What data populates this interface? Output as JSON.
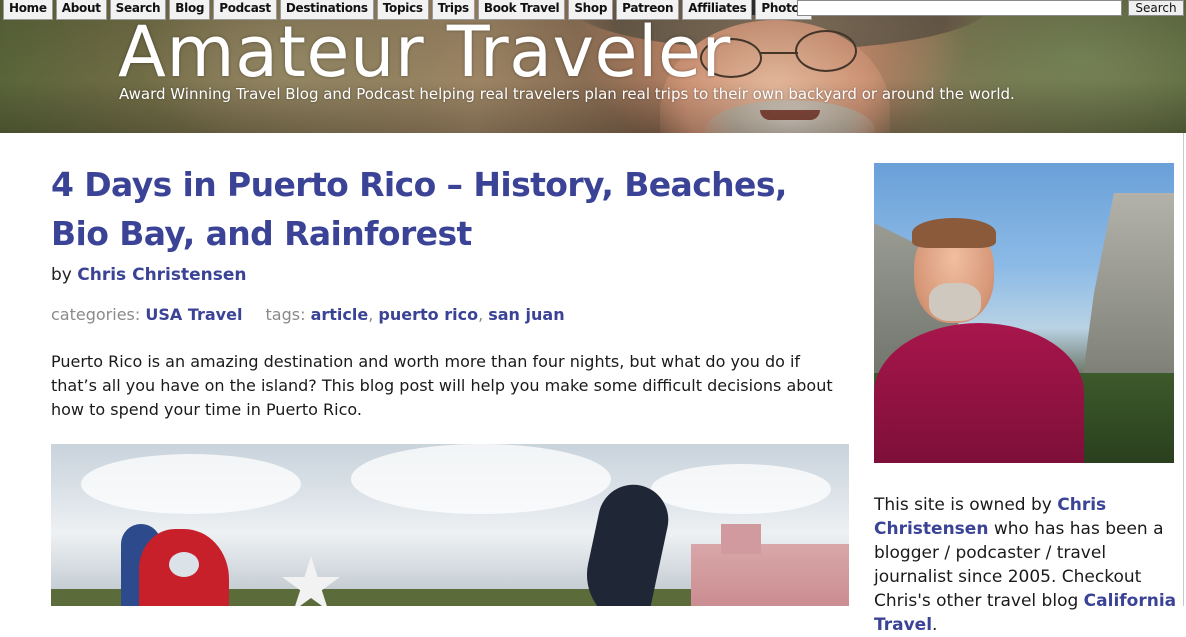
{
  "nav": {
    "items": [
      "Home",
      "About",
      "Search",
      "Blog",
      "Podcast",
      "Destinations",
      "Topics",
      "Trips",
      "Book Travel",
      "Shop",
      "Patreon",
      "Affiliates",
      "Photos"
    ],
    "search_placeholder": "",
    "search_button": "Search"
  },
  "header": {
    "title": "Amateur Traveler",
    "tagline": "Award Winning Travel Blog and Podcast helping real travelers plan real trips to their own backyard or around the world."
  },
  "post": {
    "title": "4 Days in Puerto Rico – History, Beaches, Bio Bay, and Rainforest",
    "by": "by",
    "author": "Chris Christensen",
    "categories_label": "categories:",
    "category": "USA Travel",
    "tags_label": "tags:",
    "tags": [
      "article",
      "puerto rico",
      "san juan"
    ],
    "intro": "Puerto Rico is an amazing destination and worth more than four nights, but what do you do if that’s all you have on the island? This blog post will help you make some difficult decisions about how to spend your time in Puerto Rico."
  },
  "sidebar": {
    "bio_prefix": "This site is owned by ",
    "owner_link": "Chris Christensen",
    "bio_middle": " who has has been a blogger / podcaster / travel journalist since 2005. Checkout Chris's other travel blog ",
    "other_blog_link": "California Travel",
    "bio_suffix": "."
  },
  "colors": {
    "link": "#3b4396",
    "meta": "#8a8a8a"
  }
}
